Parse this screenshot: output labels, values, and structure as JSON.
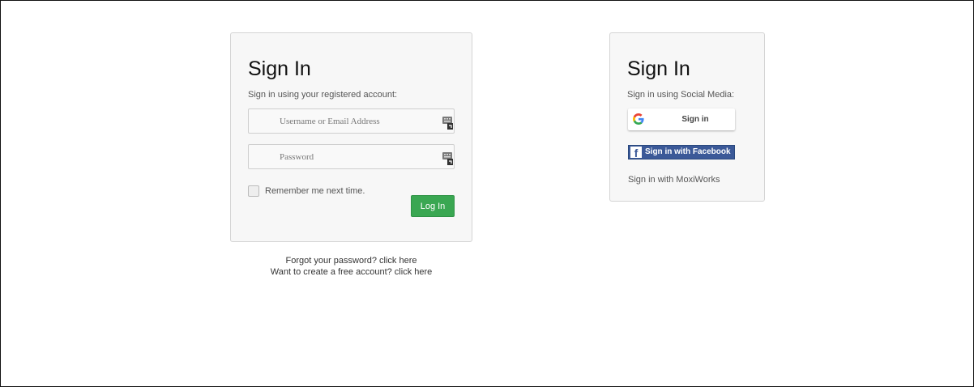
{
  "login": {
    "title": "Sign In",
    "subtitle": "Sign in using your registered account:",
    "username_placeholder": "Username or Email Address",
    "password_placeholder": "Password",
    "remember_label": "Remember me next time.",
    "login_button": "Log In",
    "forgot_text": "Forgot your password? click here",
    "create_text": "Want to create a free account? click here"
  },
  "social": {
    "title": "Sign In",
    "subtitle": "Sign in using Social Media:",
    "google_label": "Sign in",
    "facebook_label": "Sign in with Facebook",
    "facebook_icon_glyph": "f",
    "moxi_label": "Sign in with MoxiWorks"
  },
  "colors": {
    "login_button_bg": "#3aa752",
    "facebook_bg": "#3b5998",
    "card_bg": "#f7f7f7"
  },
  "icons": {
    "field_icon": "keyboard-icon",
    "google_icon": "google-logo-icon",
    "facebook_icon": "facebook-logo-icon"
  }
}
